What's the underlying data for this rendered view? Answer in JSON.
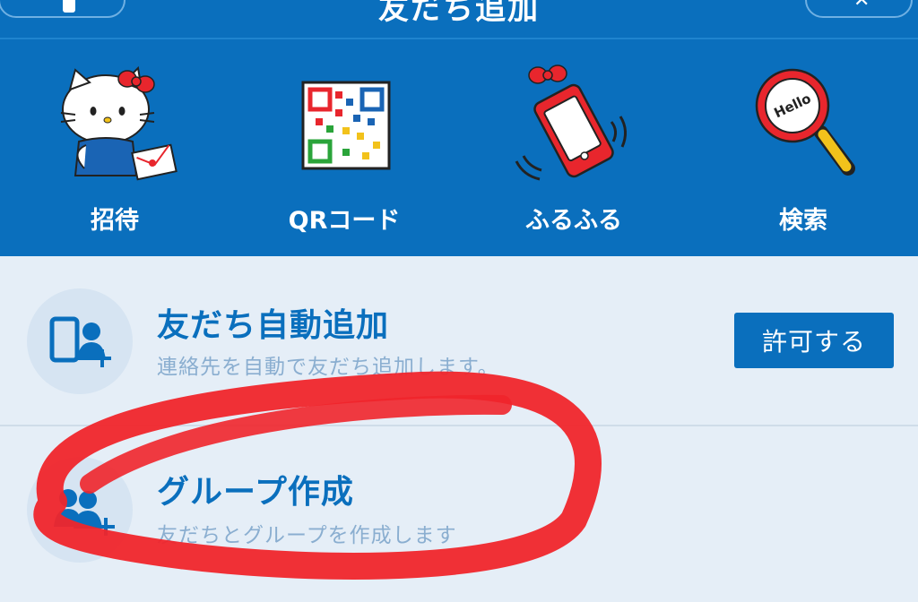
{
  "header": {
    "title": "友だち追加"
  },
  "methods": [
    {
      "label": "招待",
      "icon": "hello-kitty-invite-icon"
    },
    {
      "label": "QRコード",
      "icon": "qr-code-icon"
    },
    {
      "label": "ふるふる",
      "icon": "shaking-phone-icon"
    },
    {
      "label": "検索",
      "icon": "magnifier-hello-icon"
    }
  ],
  "rows": [
    {
      "title": "友だち自動追加",
      "subtitle": "連絡先を自動で友だち追加します。",
      "action_label": "許可する",
      "icon": "phone-add-friend-icon"
    },
    {
      "title": "グループ作成",
      "subtitle": "友だちとグループを作成します",
      "icon": "group-add-icon"
    }
  ],
  "colors": {
    "primary": "#0a6fbd",
    "background": "#e5eef7",
    "subtitle": "#8aaed0",
    "annotation": "#f0252b"
  }
}
